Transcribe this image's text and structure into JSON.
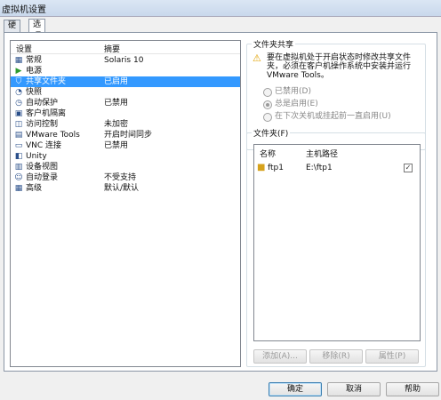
{
  "window": {
    "title": "虚拟机设置"
  },
  "tabs": [
    {
      "label": "硬件"
    },
    {
      "label": "选项"
    }
  ],
  "settings_list": {
    "header": {
      "setting": "设置",
      "summary": "摘要"
    },
    "rows": [
      {
        "icon": "general-icon",
        "label": "常规",
        "value": "Solaris 10"
      },
      {
        "icon": "power-icon",
        "label": "电源",
        "value": ""
      },
      {
        "icon": "shared-folder-icon",
        "label": "共享文件夹",
        "value": "已启用",
        "selected": true
      },
      {
        "icon": "snapshot-icon",
        "label": "快照",
        "value": ""
      },
      {
        "icon": "autoprotect-icon",
        "label": "自动保护",
        "value": "已禁用"
      },
      {
        "icon": "guest-isolation-icon",
        "label": "客户机隔离",
        "value": ""
      },
      {
        "icon": "access-control-icon",
        "label": "访问控制",
        "value": "未加密"
      },
      {
        "icon": "vmware-tools-icon",
        "label": "VMware Tools",
        "value": "开启时间同步"
      },
      {
        "icon": "vnc-icon",
        "label": "VNC 连接",
        "value": "已禁用"
      },
      {
        "icon": "unity-icon",
        "label": "Unity",
        "value": ""
      },
      {
        "icon": "device-view-icon",
        "label": "设备视图",
        "value": ""
      },
      {
        "icon": "autologin-icon",
        "label": "自动登录",
        "value": "不受支持"
      },
      {
        "icon": "advanced-icon",
        "label": "高级",
        "value": "默认/默认"
      }
    ]
  },
  "sharing": {
    "title": "文件夹共享",
    "warning": "要在虚拟机处于开启状态时修改共享文件夹，必须在客户机操作系统中安装并运行 VMware Tools。",
    "options": [
      {
        "label": "已禁用(D)",
        "checked": false
      },
      {
        "label": "总是启用(E)",
        "checked": true
      },
      {
        "label": "在下次关机或挂起前一直启用(U)",
        "checked": false
      }
    ]
  },
  "folders": {
    "title": "文件夹(F)",
    "columns": {
      "name": "名称",
      "host_path": "主机路径"
    },
    "rows": [
      {
        "name": "ftp1",
        "path": "E:\\ftp1",
        "enabled": true
      }
    ],
    "buttons": {
      "add": "添加(A)...",
      "remove": "移除(R)",
      "properties": "属性(P)"
    }
  },
  "footer": {
    "ok": "确定",
    "cancel": "取消",
    "help": "帮助"
  }
}
